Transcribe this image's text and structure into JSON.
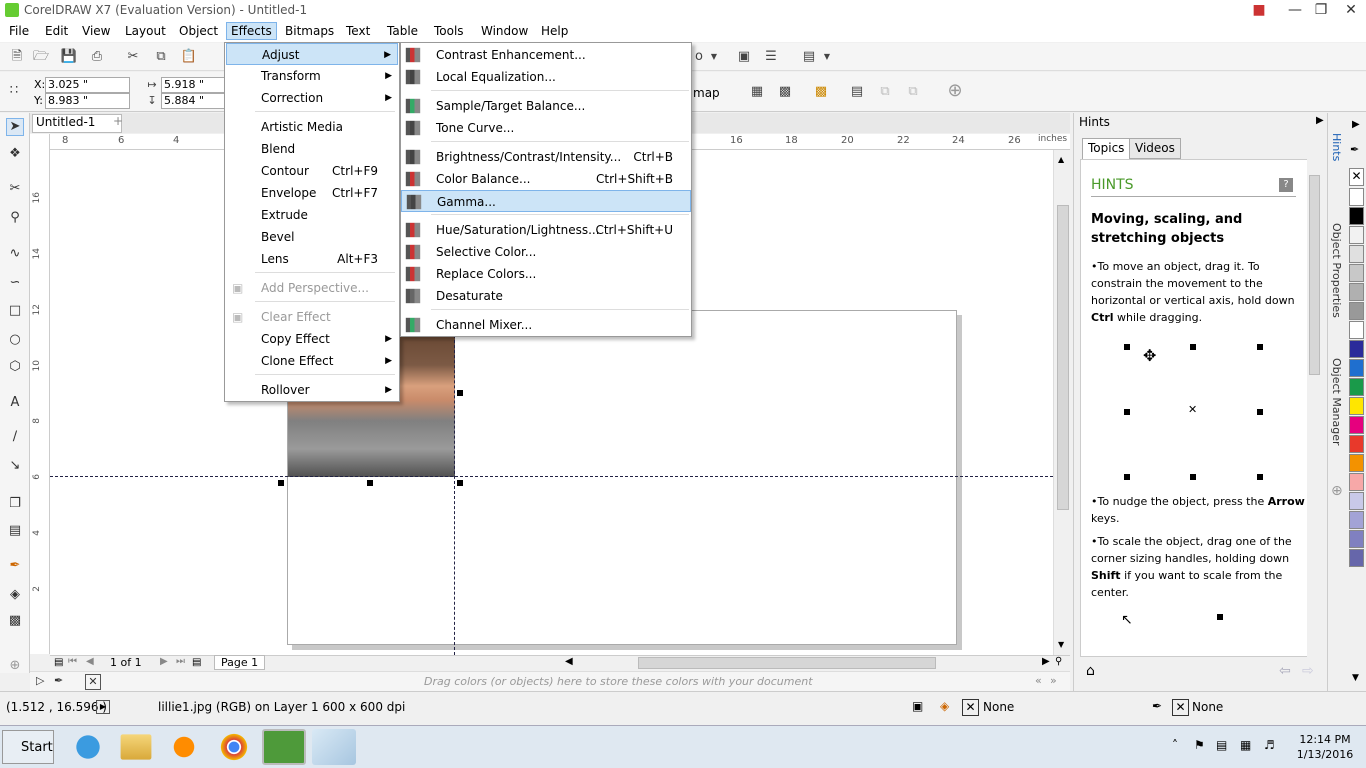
{
  "window": {
    "title": "CorelDRAW X7 (Evaluation Version) - Untitled-1"
  },
  "menubar": [
    "File",
    "Edit",
    "View",
    "Layout",
    "Object",
    "Effects",
    "Bitmaps",
    "Text",
    "Table",
    "Tools",
    "Window",
    "Help"
  ],
  "properties": {
    "x_label": "X:",
    "x_value": "3.025 \"",
    "y_label": "Y:",
    "y_value": "8.983 \"",
    "w_value": "5.918 \"",
    "h_value": "5.884 \""
  },
  "toolbar_partial": {
    "text1": "o",
    "text2": "map"
  },
  "document_tab": "Untitled-1",
  "ruler": {
    "h_ticks": [
      "8",
      "6",
      "4",
      "16",
      "18",
      "20",
      "22",
      "24",
      "26"
    ],
    "units": "inches",
    "v_ticks": [
      "16",
      "14",
      "12",
      "10",
      "8",
      "6",
      "4",
      "2"
    ]
  },
  "pagenav": {
    "count": "1 of 1",
    "page": "Page 1"
  },
  "palette_hint": "Drag colors (or objects) here to store these colors with your document",
  "effects_menu": [
    {
      "label": "Adjust",
      "submenu": true,
      "active": true
    },
    {
      "label": "Transform",
      "submenu": true
    },
    {
      "label": "Correction",
      "submenu": true
    },
    {
      "label": "Artistic Media"
    },
    {
      "label": "Blend"
    },
    {
      "label": "Contour",
      "shortcut": "Ctrl+F9"
    },
    {
      "label": "Envelope",
      "shortcut": "Ctrl+F7"
    },
    {
      "label": "Extrude"
    },
    {
      "label": "Bevel"
    },
    {
      "label": "Lens",
      "shortcut": "Alt+F3"
    },
    {
      "label": "Add Perspective...",
      "disabled": true
    },
    {
      "label": "Clear Effect",
      "disabled": true
    },
    {
      "label": "Copy Effect",
      "submenu": true
    },
    {
      "label": "Clone Effect",
      "submenu": true
    },
    {
      "label": "Rollover",
      "submenu": true
    }
  ],
  "adjust_menu": [
    {
      "label": "Contrast Enhancement..."
    },
    {
      "label": "Local Equalization..."
    },
    {
      "label": "Sample/Target Balance..."
    },
    {
      "label": "Tone Curve..."
    },
    {
      "label": "Brightness/Contrast/Intensity...",
      "shortcut": "Ctrl+B"
    },
    {
      "label": "Color Balance...",
      "shortcut": "Ctrl+Shift+B"
    },
    {
      "label": "Gamma...",
      "highlighted": true
    },
    {
      "label": "Hue/Saturation/Lightness...",
      "shortcut": "Ctrl+Shift+U"
    },
    {
      "label": "Selective Color..."
    },
    {
      "label": "Replace Colors..."
    },
    {
      "label": "Desaturate"
    },
    {
      "label": "Channel Mixer..."
    }
  ],
  "hints": {
    "panel_title": "Hints",
    "tabs": [
      "Topics",
      "Videos"
    ],
    "heading": "HINTS",
    "topic": "Moving, scaling, and stretching objects",
    "p1a": "•To move an object, drag it. To constrain the movement to the horizontal or vertical axis, hold down ",
    "p1b": "Ctrl",
    "p1c": " while dragging.",
    "p2a": "•To nudge the object, press the ",
    "p2b": "Arrow",
    "p2c": " keys.",
    "p3a": "•To scale the object, drag one of the corner sizing handles, holding down ",
    "p3b": "Shift",
    "p3c": " if you want to scale from the center."
  },
  "side_tabs": [
    "Hints",
    "Object Properties",
    "Object Manager"
  ],
  "palette_colors": [
    "#ffffff",
    "#000000",
    "#f2f2f2",
    "#e0e0e0",
    "#c8c8c8",
    "#b0b0b0",
    "#999999",
    "#ffffff",
    "#2b2b9a",
    "#1f6fcf",
    "#1a9a4a",
    "#ffe600",
    "#e6007e",
    "#e8392b",
    "#f39200",
    "#f7a8a8",
    "#c9c9e8",
    "#a3a3d6",
    "#8080c0",
    "#6666aa"
  ],
  "status": {
    "coords": "(1.512 , 16.596 )",
    "object": "lillie1.jpg (RGB) on Layer 1 600 x 600 dpi",
    "fill": "None",
    "outline": "None"
  },
  "taskbar": {
    "start": "Start",
    "time": "12:14 PM",
    "date": "1/13/2016"
  }
}
